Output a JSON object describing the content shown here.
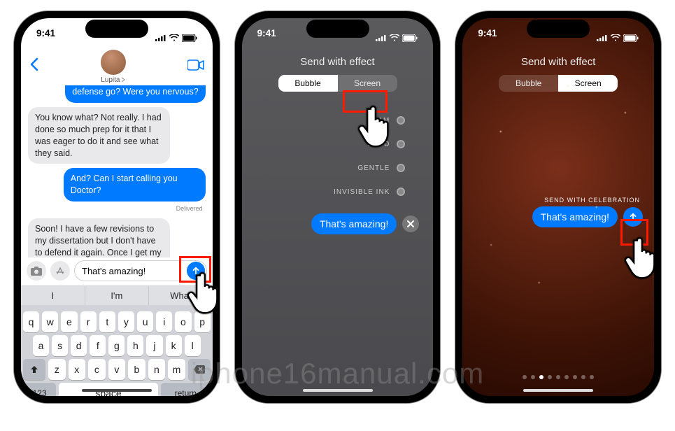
{
  "status": {
    "time": "9:41",
    "signal_icon": "signal-icon",
    "wifi_icon": "wifi-icon",
    "battery_icon": "battery-icon"
  },
  "phone1": {
    "contact_name": "Lupita",
    "messages": {
      "m0": "defense go? Were you nervous?",
      "m1": "You know what? Not really. I had done so much prep for it that I was eager to do it and see what they said.",
      "m2": "And? Can I start calling you Doctor?",
      "delivered": "Delivered",
      "m3": "Soon! I have a few revisions to my dissertation but I don't have to defend it again. Once I get my supervisor to sign off and submit the final version, I'm done!"
    },
    "composer_text": "That's amazing!",
    "predictive": {
      "a": "I",
      "b": "I'm",
      "c": "What"
    },
    "keyboard": {
      "row1": [
        "q",
        "w",
        "e",
        "r",
        "t",
        "y",
        "u",
        "i",
        "o",
        "p"
      ],
      "row2": [
        "a",
        "s",
        "d",
        "f",
        "g",
        "h",
        "j",
        "k",
        "l"
      ],
      "row3": [
        "z",
        "x",
        "c",
        "v",
        "b",
        "n",
        "m"
      ],
      "num": "123",
      "space": "space",
      "return": "return"
    }
  },
  "effects": {
    "title": "Send with effect",
    "tab_bubble": "Bubble",
    "tab_screen": "Screen",
    "options": {
      "slam": "SLAM",
      "loud": "LOUD",
      "gentle": "GENTLE",
      "invisible": "INVISIBLE INK"
    },
    "preview_text": "That's amazing!"
  },
  "celebration": {
    "title": "Send with effect",
    "tab_bubble": "Bubble",
    "tab_screen": "Screen",
    "label": "SEND WITH CELEBRATION",
    "preview_text": "That's amazing!",
    "page_count": 9,
    "page_active": 2
  },
  "watermark": "iphone16manual.com"
}
